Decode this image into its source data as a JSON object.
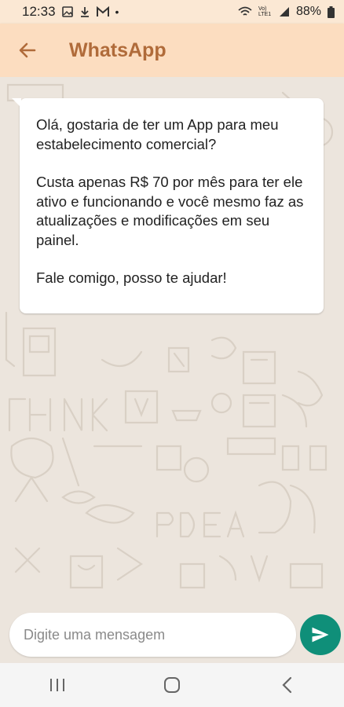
{
  "status_bar": {
    "time": "12:33",
    "battery": "88%",
    "network_label": "Vo) LTE1"
  },
  "app_bar": {
    "title": "WhatsApp"
  },
  "message": {
    "paragraphs": [
      "Olá, gostaria de ter um App para meu estabelecimento comercial?",
      "Custa apenas R$ 70 por mês para ter ele ativo e funcionando e você mesmo faz as atualizações e modificações em seu painel.",
      "Fale comigo, posso te ajudar!"
    ]
  },
  "composer": {
    "placeholder": "Digite uma mensagem"
  },
  "colors": {
    "appbar": "#fcddc0",
    "title": "#b06b3a",
    "send_button": "#0f8f79",
    "chat_background": "#ece5dd"
  },
  "icons": {
    "back": "arrow-left-icon",
    "send": "send-icon",
    "nav_recent": "recent-apps-icon",
    "nav_home": "home-icon",
    "nav_back": "nav-back-icon"
  }
}
